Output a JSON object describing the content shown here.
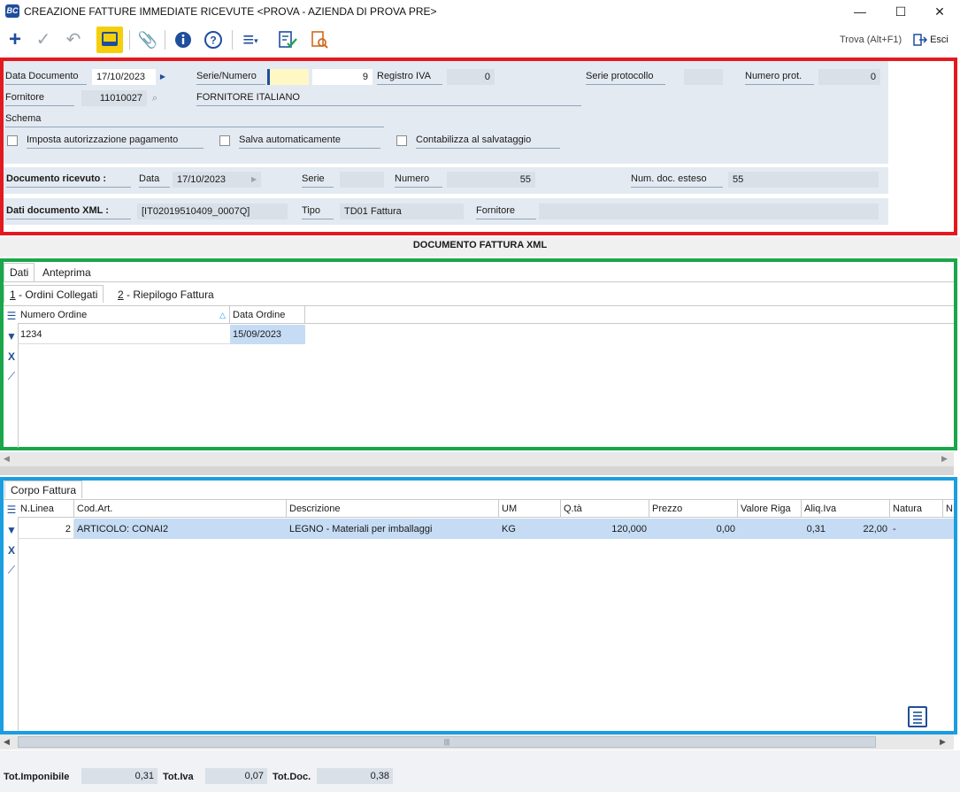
{
  "window": {
    "app_icon": "BC",
    "title": "CREAZIONE FATTURE IMMEDIATE RICEVUTE <PROVA - AZIENDA DI PROVA PRE>",
    "minimize": "—",
    "maximize": "☐",
    "close": "✕"
  },
  "toolbar": {
    "search_placeholder": "Trova (Alt+F1)",
    "exit_label": "Esci",
    "icons": [
      "add-icon",
      "confirm-icon",
      "undo-icon",
      "view-icon",
      "attach-icon",
      "info-icon",
      "help-icon",
      "menu-icon",
      "checklist-icon",
      "search-doc-icon"
    ]
  },
  "header": {
    "data_documento_label": "Data Documento",
    "data_documento_value": "17/10/2023",
    "serie_numero_label": "Serie/Numero",
    "serie_value": "",
    "numero_value": "9",
    "registro_iva_label": "Registro IVA",
    "registro_iva_value": "0",
    "serie_protocollo_label": "Serie protocollo",
    "serie_protocollo_value": "",
    "numero_prot_label": "Numero prot.",
    "numero_prot_value": "0",
    "fornitore_label": "Fornitore",
    "fornitore_code": "11010027",
    "fornitore_name": "FORNITORE ITALIANO",
    "schema_label": "Schema",
    "imposta_autorizzazione_label": "Imposta autorizzazione pagamento",
    "salva_automaticamente_label": "Salva automaticamente",
    "contabilizza_label": "Contabilizza al salvataggio",
    "doc_ricevuto_label": "Documento ricevuto :",
    "data_label": "Data",
    "data_ricevuto_value": "17/10/2023",
    "serie_label": "Serie",
    "serie_ricevuto_value": "",
    "numero_label": "Numero",
    "numero_ricevuto_value": "55",
    "num_doc_esteso_label": "Num. doc. esteso",
    "num_doc_esteso_value": "55",
    "dati_xml_label": "Dati documento XML :",
    "dati_xml_value": "[IT02019510409_0007Q]",
    "tipo_label": "Tipo",
    "tipo_value": "TD01 Fattura",
    "fornitore_xml_label": "Fornitore",
    "fornitore_xml_value": ""
  },
  "section_title": "DOCUMENTO FATTURA XML",
  "tabs": {
    "main": [
      "Dati",
      "Anteprima"
    ],
    "sub1_num": "1",
    "sub1_label": " - Ordini Collegati",
    "sub2_num": "2",
    "sub2_label": " - Riepilogo Fattura",
    "corpo": "Corpo Fattura"
  },
  "orders_table": {
    "columns": [
      "Numero Ordine",
      "Data Ordine"
    ],
    "rows": [
      [
        "1234",
        "15/09/2023"
      ]
    ]
  },
  "body_table": {
    "columns": [
      "N.Linea",
      "Cod.Art.",
      "Descrizione",
      "UM",
      "Q.tà",
      "Prezzo",
      "Valore Riga",
      "Aliq.Iva",
      "Natura",
      "N"
    ],
    "rows": [
      [
        "2",
        "ARTICOLO: CONAI2",
        "LEGNO - Materiali per imballaggi",
        "KG",
        "120,000",
        "0,00",
        "0,31",
        "22,00",
        "-"
      ]
    ]
  },
  "totals": {
    "imponibile_label": "Tot.Imponibile",
    "imponibile_value": "0,31",
    "iva_label": "Tot.Iva",
    "iva_value": "0,07",
    "doc_label": "Tot.Doc.",
    "doc_value": "0,38"
  },
  "colors": {
    "red_frame": "#e3191f",
    "green_frame": "#1aa64a",
    "blue_frame": "#1a9ee0",
    "selected_row": "#c5dcf4",
    "panel_bg": "#e4eaf1",
    "highlight_field": "#fff8c4"
  }
}
